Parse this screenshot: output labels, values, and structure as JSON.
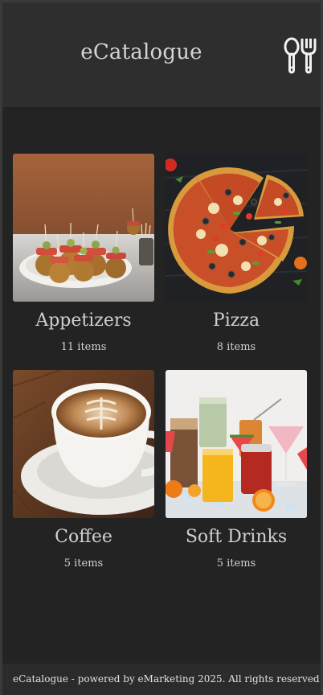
{
  "header": {
    "title": "eCatalogue",
    "icon": "utensils-icon"
  },
  "categories": [
    {
      "name": "Appetizers",
      "count": "11 items",
      "image": "appetizers-image"
    },
    {
      "name": "Pizza",
      "count": "8 items",
      "image": "pizza-image"
    },
    {
      "name": "Coffee",
      "count": "5 items",
      "image": "coffee-image"
    },
    {
      "name": "Soft Drinks",
      "count": "5 items",
      "image": "soft-drinks-image"
    }
  ],
  "footer": {
    "text": "eCatalogue - powered by eMarketing 2025. All rights reserved."
  },
  "colors": {
    "background": "#232323",
    "header": "#2e2e2e",
    "text": "#d4d4d4"
  }
}
